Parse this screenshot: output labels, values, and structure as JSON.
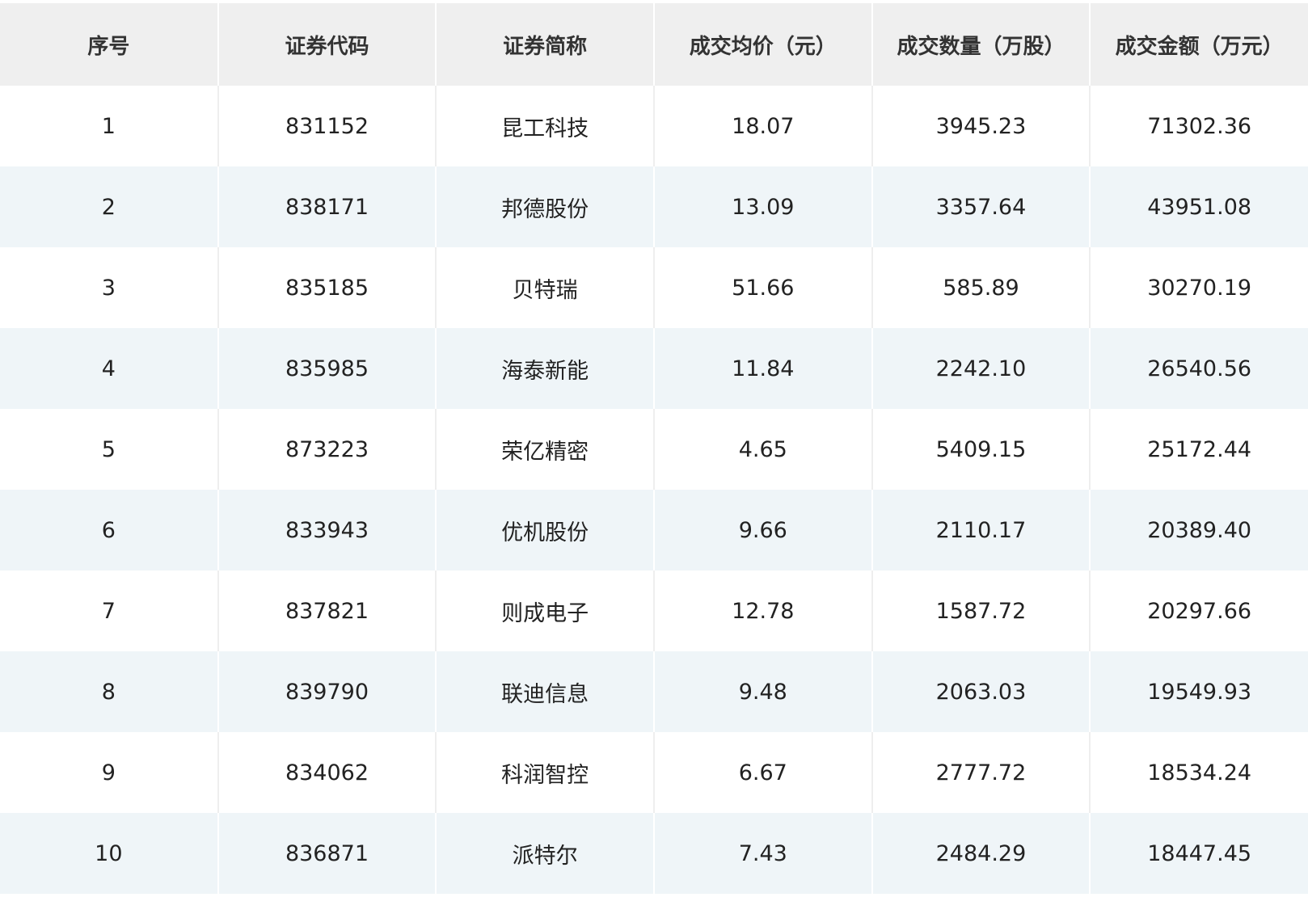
{
  "table": {
    "headers": [
      "序号",
      "证券代码",
      "证券简称",
      "成交均价（元）",
      "成交数量（万股）",
      "成交金额（万元）"
    ],
    "rows": [
      [
        "1",
        "831152",
        "昆工科技",
        "18.07",
        "3945.23",
        "71302.36"
      ],
      [
        "2",
        "838171",
        "邦德股份",
        "13.09",
        "3357.64",
        "43951.08"
      ],
      [
        "3",
        "835185",
        "贝特瑞",
        "51.66",
        "585.89",
        "30270.19"
      ],
      [
        "4",
        "835985",
        "海泰新能",
        "11.84",
        "2242.10",
        "26540.56"
      ],
      [
        "5",
        "873223",
        "荣亿精密",
        "4.65",
        "5409.15",
        "25172.44"
      ],
      [
        "6",
        "833943",
        "优机股份",
        "9.66",
        "2110.17",
        "20389.40"
      ],
      [
        "7",
        "837821",
        "则成电子",
        "12.78",
        "1587.72",
        "20297.66"
      ],
      [
        "8",
        "839790",
        "联迪信息",
        "9.48",
        "2063.03",
        "19549.93"
      ],
      [
        "9",
        "834062",
        "科润智控",
        "6.67",
        "2777.72",
        "18534.24"
      ],
      [
        "10",
        "836871",
        "派特尔",
        "7.43",
        "2484.29",
        "18447.45"
      ]
    ]
  },
  "colors": {
    "header_bg": "#efefef",
    "stripe_bg": "#eff5f8",
    "row_bg": "#ffffff"
  }
}
